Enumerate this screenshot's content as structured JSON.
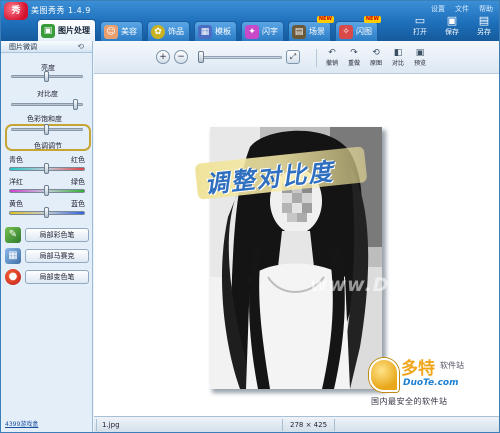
{
  "app": {
    "logo": "秀",
    "title": "美图秀秀 1.4.9"
  },
  "sys_menu": [
    "设置",
    "文件",
    "帮助"
  ],
  "tabs": [
    {
      "label": "图片处理",
      "icon": "photo-icon",
      "active": true
    },
    {
      "label": "美容",
      "icon": "face-icon"
    },
    {
      "label": "饰品",
      "icon": "decoration-icon"
    },
    {
      "label": "模板",
      "icon": "frame-icon"
    },
    {
      "label": "闪字",
      "icon": "sparkle-text-icon"
    },
    {
      "label": "场景",
      "icon": "scene-icon",
      "badge": "NEW"
    },
    {
      "label": "闪图",
      "icon": "flash-image-icon",
      "badge": "NEW"
    }
  ],
  "top_tools": {
    "open": "打开",
    "save": "保存",
    "save_as": "另存"
  },
  "left_panel": {
    "title": "图片微调",
    "brightness": {
      "label": "亮度",
      "level": 0.5
    },
    "contrast": {
      "label": "对比度",
      "level": 0.9
    },
    "saturation": {
      "label": "色彩饱和度",
      "level": 0.5
    },
    "color_adjust": "色调调节",
    "color_rows": [
      {
        "left": "青色",
        "right": "红色",
        "level": 0.5
      },
      {
        "left": "洋红",
        "right": "绿色",
        "level": 0.5
      },
      {
        "left": "黄色",
        "right": "蓝色",
        "level": 0.5
      }
    ],
    "brushes": [
      "局部彩色笔",
      "局部马赛克",
      "局部变色笔"
    ],
    "link": "4399游戏盒"
  },
  "toolbar": {
    "zoom_in": "+",
    "zoom_out": "−",
    "buttons": [
      "撤销",
      "重做",
      "原图",
      "对比",
      "预览"
    ]
  },
  "canvas": {
    "annotation": "调整对比度",
    "watermark_center": "www.DuoTe.com",
    "logo_watermark": {
      "brand": "多特",
      "brand_tag": "软件站",
      "site": "DuoTe.com",
      "slogan": "国内最安全的软件站"
    }
  },
  "status": {
    "filename": "1.jpg",
    "dimensions": "278 × 425"
  },
  "colors": {
    "title_bar": "#1e6fba",
    "highlight_ring": "#c6a532",
    "annotation_text": "#2f6fbf",
    "brand_orange": "#f0a51a"
  }
}
